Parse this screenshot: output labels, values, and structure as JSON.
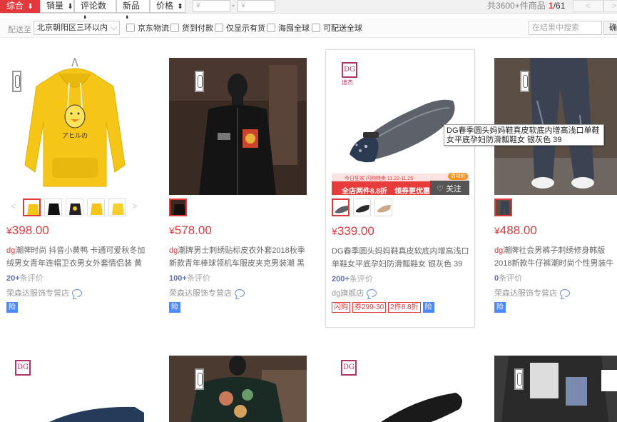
{
  "sort": {
    "buttons": [
      {
        "label": "综合",
        "arrow": "⬇"
      },
      {
        "label": "销量",
        "arrow": "⬇"
      },
      {
        "label": "评论数",
        "arrow": "⬇"
      },
      {
        "label": "新品",
        "arrow": "⬇"
      },
      {
        "label": "价格",
        "arrow": "⬍"
      }
    ],
    "price_min_placeholder": "¥",
    "price_max_placeholder": "¥",
    "dash": "-",
    "total": "共3600+件商品",
    "page_current": "1",
    "page_total": "/61",
    "prev": "<",
    "next": ">"
  },
  "filters": {
    "ship_label": "配送至",
    "address": "北京朝阳区三环以内",
    "checkboxes": [
      "京东物流",
      "货到付款",
      "仅显示有货",
      "海囤全球",
      "可配送全球"
    ],
    "search_placeholder": "在结果中搜索",
    "search_button": "确"
  },
  "products": [
    {
      "price_symbol": "¥",
      "price": "398.00",
      "title_hl": "dg",
      "title": "潮牌时尚 抖音小黄鸭 卡通可爱秋冬加绒男女青年连帽卫衣男女外套情侣装 黄色",
      "review_count": "20+",
      "review_suffix": "条评价",
      "shop": "荣森达服饰专营店",
      "badges": [
        {
          "text": "险",
          "type": "blue"
        }
      ]
    },
    {
      "price_symbol": "¥",
      "price": "578.00",
      "title_hl": "dg",
      "title": "潮牌男士刺绣贴标皮衣外套2018秋季新款青年棒球领机车服皮夹克男装潮 黑色",
      "review_count": "100+",
      "review_suffix": "条评价",
      "shop": "荣森达服饰专营店",
      "badges": [
        {
          "text": "险",
          "type": "blue"
        }
      ]
    },
    {
      "price_symbol": "¥",
      "price": "339.00",
      "title_hl": "",
      "title": "DG春季圆头妈妈鞋真皮软底内增高浅口单鞋女平底孕妇防滑瓢鞋女 银灰色 39",
      "review_count": "200+",
      "review_suffix": "条评价",
      "shop": "dg旗舰店",
      "badges": [
        {
          "text": "闪购",
          "type": "red"
        },
        {
          "text": "券299-30",
          "type": "red"
        },
        {
          "text": "2件8.8折",
          "type": "red"
        },
        {
          "text": "险",
          "type": "blue"
        }
      ],
      "brand_logo": "DG",
      "brand_sub": "迪杰",
      "banner_left": "全店两件8.8折",
      "banner_mid": "领券更优惠",
      "banner_follow": "关注",
      "banner_top": "今日狂欢  闪购特卖 11.22-11.25",
      "banner_tag": "活动价"
    },
    {
      "price_symbol": "¥",
      "price": "488.00",
      "title_hl": "dg",
      "title": "潮牌社会男裤子刺绣修身韩版2018新款牛仔裤潮时尚个性男装牛仔裤 黑色",
      "review_count": "0",
      "review_suffix": "条评价",
      "shop": "荣森达服饰专营店",
      "badges": [
        {
          "text": "险",
          "type": "blue"
        }
      ]
    }
  ],
  "row2": {
    "logo_a": "DG",
    "logo_b": "DG"
  },
  "tooltip": "DG春季圆头妈妈鞋真皮软底内增高浅口单鞋女平底孕妇防滑瓢鞋女 银灰色 39"
}
